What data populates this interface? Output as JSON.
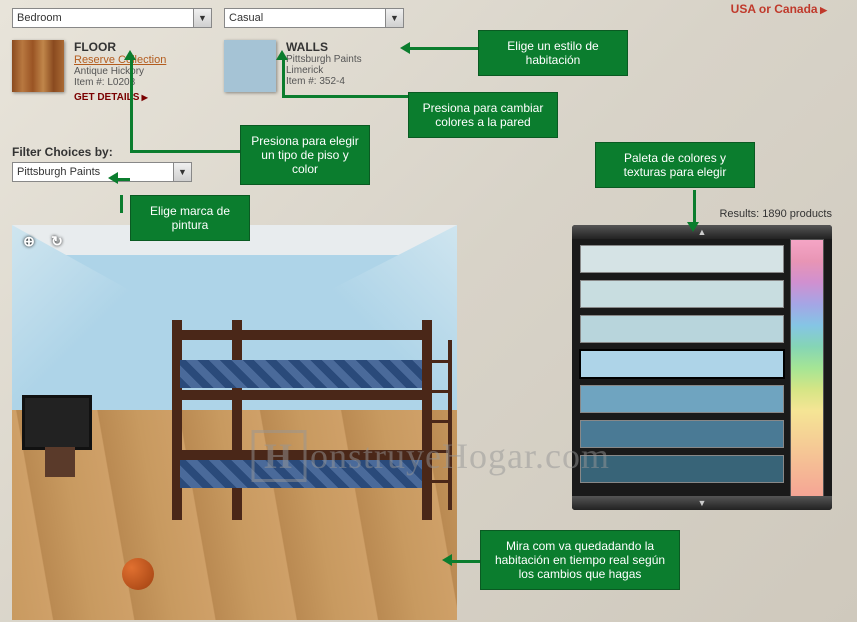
{
  "top_link": "USA or Canada",
  "dropdowns": {
    "room": "Bedroom",
    "style": "Casual",
    "filter": "Pittsburgh Paints"
  },
  "floor": {
    "title": "FLOOR",
    "collection": "Reserve Collection",
    "name": "Antique Hickory",
    "item": "Item #: L0208",
    "details": "GET DETAILS"
  },
  "walls": {
    "title": "WALLS",
    "brand": "Pittsburgh Paints",
    "name": "Limerick",
    "item": "Item #: 352-4"
  },
  "filter_label": "Filter Choices by:",
  "results": "Results: 1890 products",
  "palette_colors": [
    "#d5e3e5",
    "#c8dde0",
    "#b8d5dc",
    "#aed4e8",
    "#6fa4c0",
    "#4a7a95",
    "#386478"
  ],
  "selected_color_index": 3,
  "callouts": {
    "style": "Elige un estilo de habitación",
    "walls": "Presiona para cambiar colores a la pared",
    "floor": "Presiona para elegir un tipo de piso y color",
    "brand": "Elige marca de pintura",
    "palette": "Paleta de colores y texturas para elegir",
    "preview": "Mira com va quedadando la habitación en tiempo real según los cambios que hagas"
  },
  "watermark": "onstruyeHogar.com"
}
